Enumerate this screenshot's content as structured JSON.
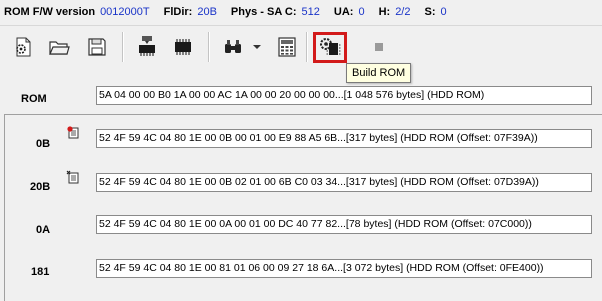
{
  "status": {
    "rom_fw_label": "ROM F/W version",
    "rom_fw_value": "0012000T",
    "fldir_label": "FlDir:",
    "fldir_value": "20B",
    "phys_label": "Phys - SA C:",
    "phys_value": "512",
    "ua_label": "UA:",
    "ua_value": "0",
    "h_label": "H:",
    "h_value": "2/2",
    "s_label": "S:",
    "s_value": "0"
  },
  "toolbar": {
    "buttons": [
      {
        "name": "settings-doc-icon"
      },
      {
        "name": "open-folder-icon"
      },
      {
        "name": "save-disk-icon"
      },
      {
        "name": "chip-read-icon"
      },
      {
        "name": "chip-icon"
      },
      {
        "name": "binoculars-icon"
      },
      {
        "name": "dropdown-arrow-icon"
      },
      {
        "name": "calculator-icon"
      },
      {
        "name": "build-rom-icon"
      },
      {
        "name": "stop-icon"
      }
    ],
    "tooltip": "Build ROM"
  },
  "rom": {
    "label": "ROM",
    "value": "5A 04 00 00 B0 1A 00 00 AC 1A 00 00 20 00 00 00...[1 048 576 bytes] (HDD ROM)"
  },
  "modules": [
    {
      "label": "0B",
      "value": "52 4F 59 4C 04 80 1E 00 0B 00 01 00 E9 88 A5 6B...[317 bytes] (HDD ROM (Offset: 07F39A))"
    },
    {
      "label": "20B",
      "value": "52 4F 59 4C 04 80 1E 00 0B 02 01 00 6B C0 03 34...[317 bytes] (HDD ROM (Offset: 07D39A))"
    },
    {
      "label": "0A",
      "value": "52 4F 59 4C 04 80 1E 00 0A 00 01 00 DC 40 77 82...[78 bytes] (HDD ROM (Offset: 07C000))"
    },
    {
      "label": "181",
      "value": "52 4F 59 4C 04 80 1E 00 81 01 06 00 09 27 18 6A...[3 072 bytes] (HDD ROM (Offset: 0FE400))"
    }
  ]
}
